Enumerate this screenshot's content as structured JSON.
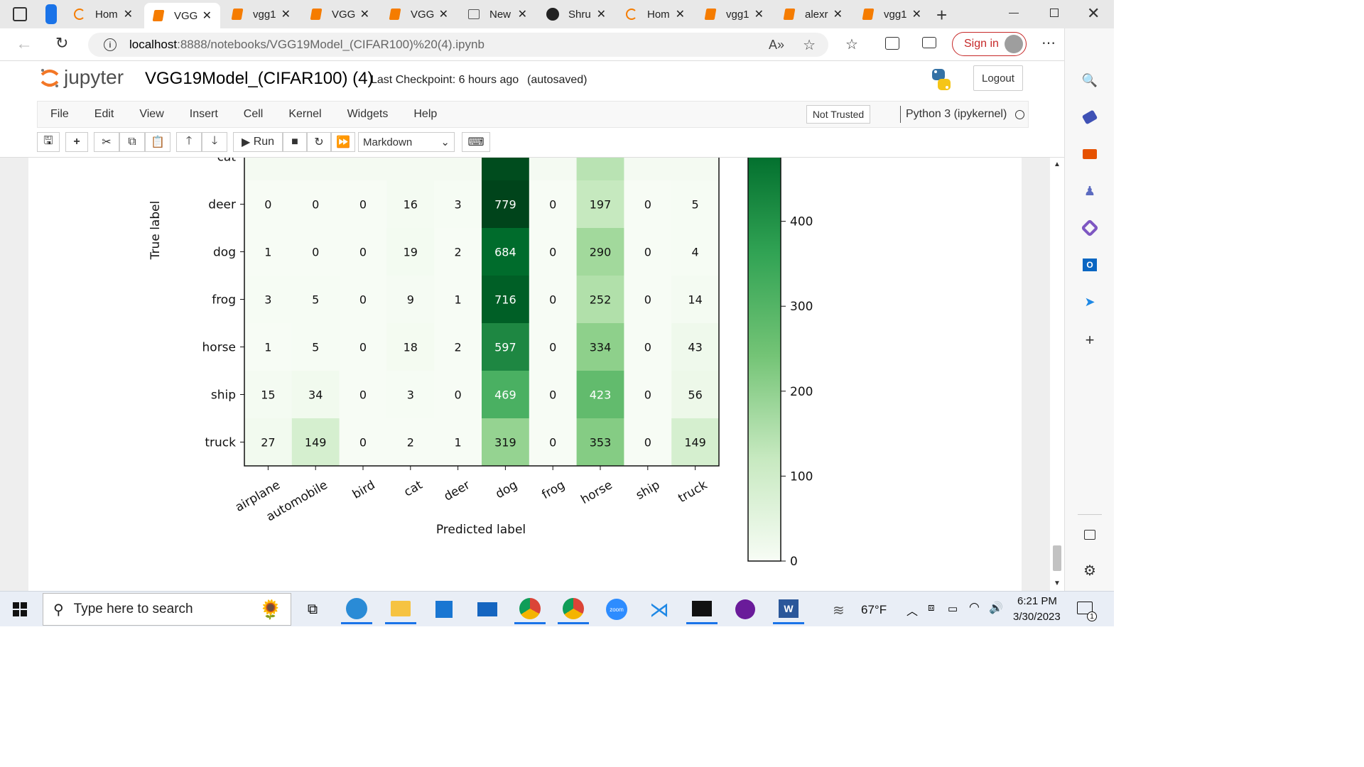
{
  "browser": {
    "tabs": [
      {
        "label": "Hom",
        "icon": "home-loader-icon"
      },
      {
        "label": "VGG",
        "icon": "jupyter-book-icon",
        "active": true
      },
      {
        "label": "vgg1",
        "icon": "jupyter-book-icon"
      },
      {
        "label": "VGG",
        "icon": "jupyter-book-icon"
      },
      {
        "label": "VGG",
        "icon": "jupyter-book-icon"
      },
      {
        "label": "New",
        "icon": "new-tab-icon"
      },
      {
        "label": "Shru",
        "icon": "github-icon"
      },
      {
        "label": "Hom",
        "icon": "home-loader-icon"
      },
      {
        "label": "vgg1",
        "icon": "jupyter-book-icon"
      },
      {
        "label": "alexr",
        "icon": "jupyter-book-icon"
      },
      {
        "label": "vgg1",
        "icon": "jupyter-book-icon"
      }
    ],
    "url_host": "localhost",
    "url_rest": ":8888/notebooks/VGG19Model_(CIFAR100)%20(4).ipynb",
    "sign_in": "Sign in"
  },
  "jupyter": {
    "logo_text": "jupyter",
    "notebook_name": "VGG19Model_(CIFAR100) (4)",
    "checkpoint": "Last Checkpoint: 6 hours ago",
    "autosaved": "(autosaved)",
    "logout": "Logout",
    "menu": [
      "File",
      "Edit",
      "View",
      "Insert",
      "Cell",
      "Kernel",
      "Widgets",
      "Help"
    ],
    "trust": "Not Trusted",
    "kernel": "Python 3 (ipykernel)",
    "run_label": "Run",
    "cell_type": "Markdown"
  },
  "chart_data": {
    "type": "heatmap",
    "xlabel": "Predicted label",
    "ylabel": "True label",
    "x_categories": [
      "airplane",
      "automobile",
      "bird",
      "cat",
      "deer",
      "dog",
      "frog",
      "horse",
      "ship",
      "truck"
    ],
    "y_categories": [
      "cat",
      "deer",
      "dog",
      "frog",
      "horse",
      "ship",
      "truck"
    ],
    "values": [
      [
        null,
        null,
        null,
        null,
        null,
        null,
        null,
        null,
        null,
        null
      ],
      [
        0,
        0,
        0,
        16,
        3,
        779,
        0,
        197,
        0,
        5
      ],
      [
        1,
        0,
        0,
        19,
        2,
        684,
        0,
        290,
        0,
        4
      ],
      [
        3,
        5,
        0,
        9,
        1,
        716,
        0,
        252,
        0,
        14
      ],
      [
        1,
        5,
        0,
        18,
        2,
        597,
        0,
        334,
        0,
        43
      ],
      [
        15,
        34,
        0,
        3,
        0,
        469,
        0,
        423,
        0,
        56
      ],
      [
        27,
        149,
        0,
        2,
        1,
        319,
        0,
        353,
        0,
        149
      ]
    ],
    "colorbar_ticks": [
      0,
      100,
      200,
      300,
      400
    ],
    "colormap": "Greens"
  },
  "taskbar": {
    "search_placeholder": "Type here to search",
    "temperature": "67°F",
    "time": "6:21 PM",
    "date": "3/30/2023",
    "notification_count": "1"
  }
}
